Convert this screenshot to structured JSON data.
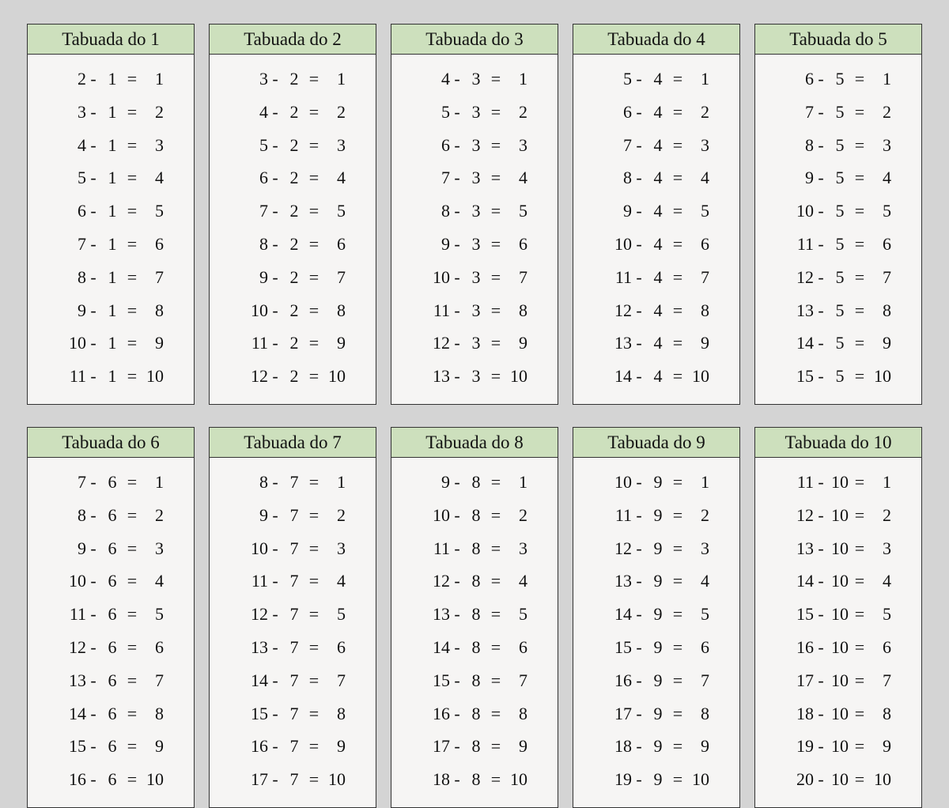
{
  "title_prefix": "Tabuada do ",
  "op": "-",
  "eq": "=",
  "tables": [
    {
      "n": 1,
      "title": "Tabuada do 1",
      "rows": [
        [
          2,
          1,
          1
        ],
        [
          3,
          1,
          2
        ],
        [
          4,
          1,
          3
        ],
        [
          5,
          1,
          4
        ],
        [
          6,
          1,
          5
        ],
        [
          7,
          1,
          6
        ],
        [
          8,
          1,
          7
        ],
        [
          9,
          1,
          8
        ],
        [
          10,
          1,
          9
        ],
        [
          11,
          1,
          10
        ]
      ]
    },
    {
      "n": 2,
      "title": "Tabuada do 2",
      "rows": [
        [
          3,
          2,
          1
        ],
        [
          4,
          2,
          2
        ],
        [
          5,
          2,
          3
        ],
        [
          6,
          2,
          4
        ],
        [
          7,
          2,
          5
        ],
        [
          8,
          2,
          6
        ],
        [
          9,
          2,
          7
        ],
        [
          10,
          2,
          8
        ],
        [
          11,
          2,
          9
        ],
        [
          12,
          2,
          10
        ]
      ]
    },
    {
      "n": 3,
      "title": "Tabuada do 3",
      "rows": [
        [
          4,
          3,
          1
        ],
        [
          5,
          3,
          2
        ],
        [
          6,
          3,
          3
        ],
        [
          7,
          3,
          4
        ],
        [
          8,
          3,
          5
        ],
        [
          9,
          3,
          6
        ],
        [
          10,
          3,
          7
        ],
        [
          11,
          3,
          8
        ],
        [
          12,
          3,
          9
        ],
        [
          13,
          3,
          10
        ]
      ]
    },
    {
      "n": 4,
      "title": "Tabuada do 4",
      "rows": [
        [
          5,
          4,
          1
        ],
        [
          6,
          4,
          2
        ],
        [
          7,
          4,
          3
        ],
        [
          8,
          4,
          4
        ],
        [
          9,
          4,
          5
        ],
        [
          10,
          4,
          6
        ],
        [
          11,
          4,
          7
        ],
        [
          12,
          4,
          8
        ],
        [
          13,
          4,
          9
        ],
        [
          14,
          4,
          10
        ]
      ]
    },
    {
      "n": 5,
      "title": "Tabuada do 5",
      "rows": [
        [
          6,
          5,
          1
        ],
        [
          7,
          5,
          2
        ],
        [
          8,
          5,
          3
        ],
        [
          9,
          5,
          4
        ],
        [
          10,
          5,
          5
        ],
        [
          11,
          5,
          6
        ],
        [
          12,
          5,
          7
        ],
        [
          13,
          5,
          8
        ],
        [
          14,
          5,
          9
        ],
        [
          15,
          5,
          10
        ]
      ]
    },
    {
      "n": 6,
      "title": "Tabuada do 6",
      "rows": [
        [
          7,
          6,
          1
        ],
        [
          8,
          6,
          2
        ],
        [
          9,
          6,
          3
        ],
        [
          10,
          6,
          4
        ],
        [
          11,
          6,
          5
        ],
        [
          12,
          6,
          6
        ],
        [
          13,
          6,
          7
        ],
        [
          14,
          6,
          8
        ],
        [
          15,
          6,
          9
        ],
        [
          16,
          6,
          10
        ]
      ]
    },
    {
      "n": 7,
      "title": "Tabuada do 7",
      "rows": [
        [
          8,
          7,
          1
        ],
        [
          9,
          7,
          2
        ],
        [
          10,
          7,
          3
        ],
        [
          11,
          7,
          4
        ],
        [
          12,
          7,
          5
        ],
        [
          13,
          7,
          6
        ],
        [
          14,
          7,
          7
        ],
        [
          15,
          7,
          8
        ],
        [
          16,
          7,
          9
        ],
        [
          17,
          7,
          10
        ]
      ]
    },
    {
      "n": 8,
      "title": "Tabuada do 8",
      "rows": [
        [
          9,
          8,
          1
        ],
        [
          10,
          8,
          2
        ],
        [
          11,
          8,
          3
        ],
        [
          12,
          8,
          4
        ],
        [
          13,
          8,
          5
        ],
        [
          14,
          8,
          6
        ],
        [
          15,
          8,
          7
        ],
        [
          16,
          8,
          8
        ],
        [
          17,
          8,
          9
        ],
        [
          18,
          8,
          10
        ]
      ]
    },
    {
      "n": 9,
      "title": "Tabuada do 9",
      "rows": [
        [
          10,
          9,
          1
        ],
        [
          11,
          9,
          2
        ],
        [
          12,
          9,
          3
        ],
        [
          13,
          9,
          4
        ],
        [
          14,
          9,
          5
        ],
        [
          15,
          9,
          6
        ],
        [
          16,
          9,
          7
        ],
        [
          17,
          9,
          8
        ],
        [
          18,
          9,
          9
        ],
        [
          19,
          9,
          10
        ]
      ]
    },
    {
      "n": 10,
      "title": "Tabuada do 10",
      "rows": [
        [
          11,
          10,
          1
        ],
        [
          12,
          10,
          2
        ],
        [
          13,
          10,
          3
        ],
        [
          14,
          10,
          4
        ],
        [
          15,
          10,
          5
        ],
        [
          16,
          10,
          6
        ],
        [
          17,
          10,
          7
        ],
        [
          18,
          10,
          8
        ],
        [
          19,
          10,
          9
        ],
        [
          20,
          10,
          10
        ]
      ]
    }
  ]
}
